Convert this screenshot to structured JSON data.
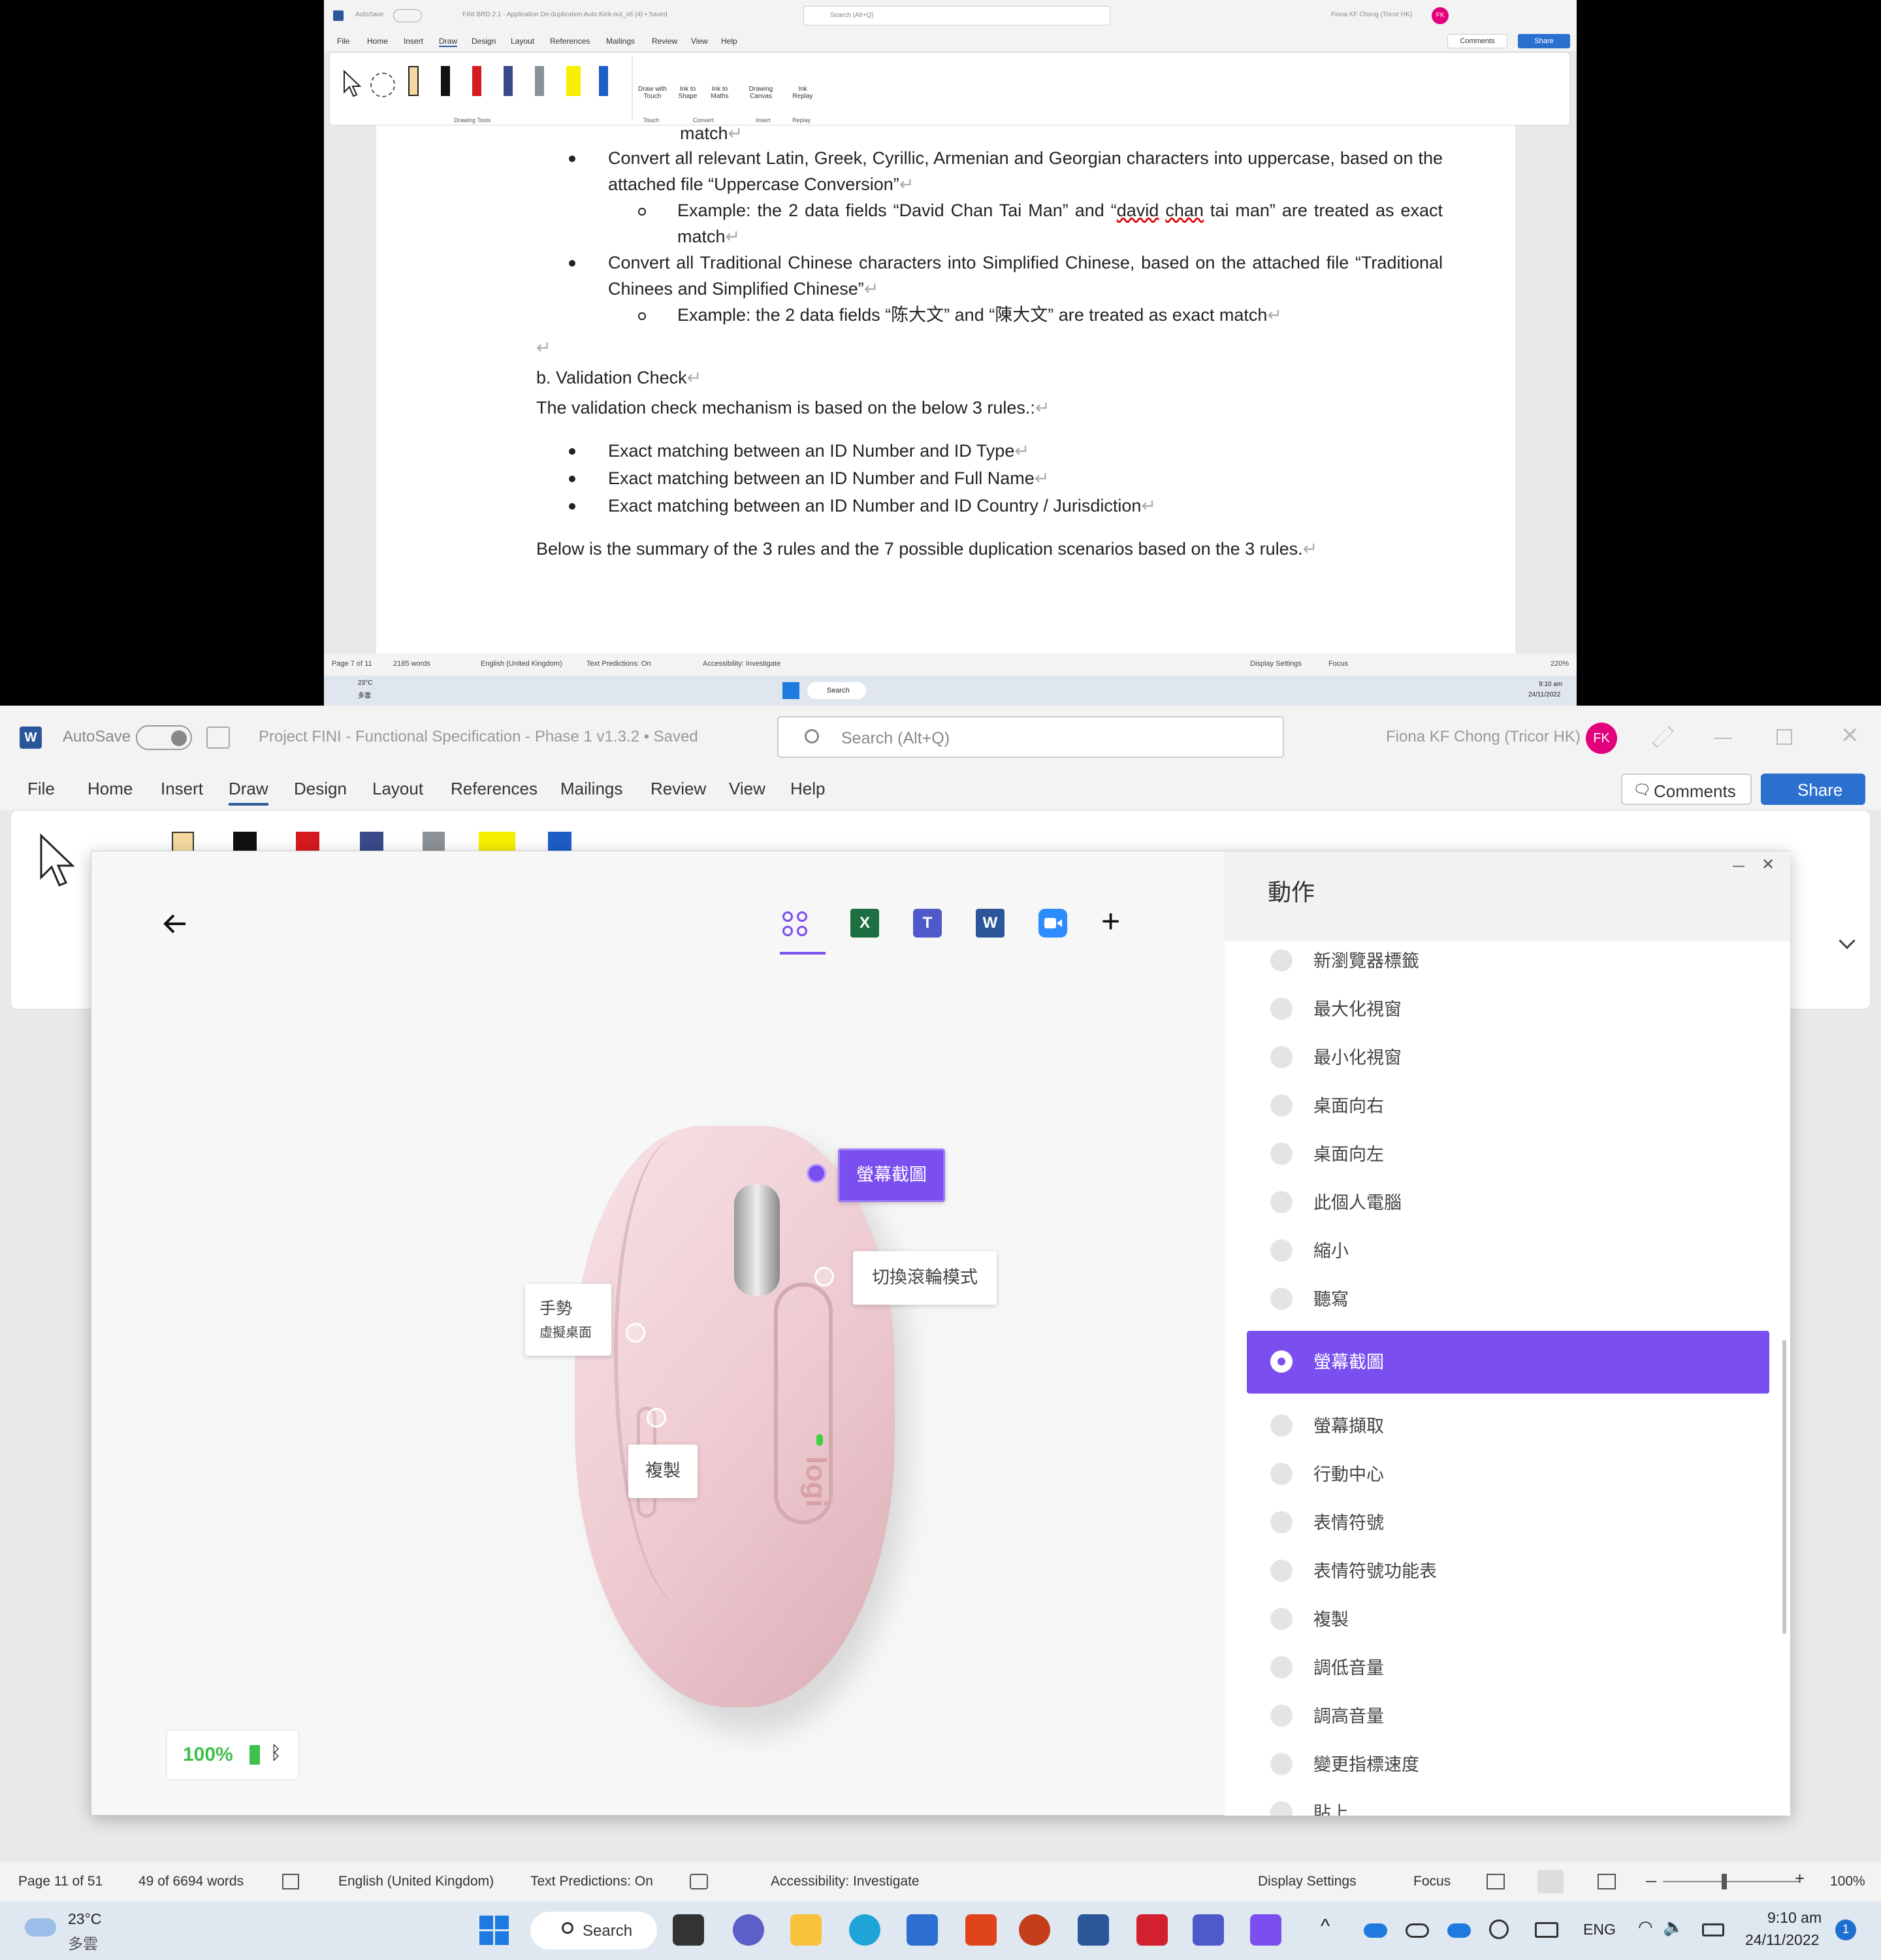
{
  "top_window": {
    "title": {
      "autosave": "AutoSave",
      "doc_title": "FINI BRD 2.1 - Application De-duplication Auto Kick-out_v6 (4) • Saved",
      "search_placeholder": "Search (Alt+Q)",
      "user": "Fiona KF Chong (Tricor HK)",
      "initials": "FK"
    },
    "menu": [
      "File",
      "Home",
      "Insert",
      "Draw",
      "Design",
      "Layout",
      "References",
      "Mailings",
      "Review",
      "View",
      "Help"
    ],
    "comments": "Comments",
    "share": "Share",
    "ribbon": {
      "touch_btn": "Draw with Touch",
      "ink_shape": "Ink to Shape",
      "ink_maths": "Ink to Maths",
      "drawing_canvas": "Drawing Canvas",
      "ink_replay": "Ink Replay",
      "groups": [
        "Drawing Tools",
        "Touch",
        "Convert",
        "Insert",
        "Replay"
      ]
    },
    "doc": {
      "line0": "match",
      "b1": "Convert all relevant Latin, Greek, Cyrillic, Armenian and Georgian characters into uppercase, based on the attached file “Uppercase Conversion”",
      "b1_ex_a": "Example: the 2 data fields “David Chan Tai Man” and “",
      "b1_ex_b1": "david",
      "b1_ex_b2": "chan",
      "b1_ex_c": " tai man” are treated as exact match",
      "b2": "Convert all Traditional Chinese characters into Simplified Chinese, based on the attached file “Traditional Chinees and Simplified Chinese”",
      "b2_ex": "Example: the 2 data fields “陈大文” and “陳大文” are treated as exact match",
      "heading": "b. Validation Check",
      "intro": "The validation check mechanism is based on the below 3 rules.:",
      "rules": [
        "Exact matching between an ID Number and ID Type",
        "Exact matching between an ID Number and Full Name",
        "Exact matching between an ID Number and ID Country / Jurisdiction"
      ],
      "summary": "Below is the summary of the 3 rules and the 7 possible duplication scenarios based on the 3 rules."
    },
    "status": {
      "page": "Page 7 of 11",
      "words": "2185 words",
      "lang": "English (United Kingdom)",
      "pred": "Text Predictions: On",
      "access": "Accessibility: Investigate",
      "display": "Display Settings",
      "focus": "Focus",
      "zoom": "220%"
    },
    "taskbar": {
      "temp": "23°C",
      "weather": "多雲",
      "search": "Search",
      "time": "9:10 am",
      "date": "24/11/2022"
    }
  },
  "word": {
    "autosave": "AutoSave",
    "doc_title": "Project FINI - Functional Specification - Phase 1 v1.3.2 • Saved",
    "search_placeholder": "Search (Alt+Q)",
    "user": "Fiona KF Chong (Tricor HK)",
    "initials": "FK",
    "menu": [
      "File",
      "Home",
      "Insert",
      "Draw",
      "Design",
      "Layout",
      "References",
      "Mailings",
      "Review",
      "View",
      "Help"
    ],
    "comments": "Comments",
    "share": "Share"
  },
  "options": {
    "panel_title": "動作",
    "battery": "100%",
    "callouts": {
      "screenshot": "螢幕截圖",
      "scroll_mode": "切換滾輪模式",
      "gesture": "手勢",
      "gesture_sub": "虛擬桌面",
      "copy": "複製"
    },
    "logo": "logi",
    "actions": [
      {
        "label": "新瀏覽器標籤",
        "selected": false
      },
      {
        "label": "最大化視窗",
        "selected": false
      },
      {
        "label": "最小化視窗",
        "selected": false
      },
      {
        "label": "桌面向右",
        "selected": false
      },
      {
        "label": "桌面向左",
        "selected": false
      },
      {
        "label": "此個人電腦",
        "selected": false
      },
      {
        "label": "縮小",
        "selected": false
      },
      {
        "label": "聽寫",
        "selected": false
      },
      {
        "label": "螢幕截圖",
        "selected": true
      },
      {
        "label": "螢幕擷取",
        "selected": false
      },
      {
        "label": "行動中心",
        "selected": false
      },
      {
        "label": "表情符號",
        "selected": false
      },
      {
        "label": "表情符號功能表",
        "selected": false
      },
      {
        "label": "複製",
        "selected": false
      },
      {
        "label": "調低音量",
        "selected": false
      },
      {
        "label": "調高音量",
        "selected": false
      },
      {
        "label": "變更指標速度",
        "selected": false
      },
      {
        "label": "貼上",
        "selected": false
      }
    ],
    "accent": "#7b4ef0"
  },
  "status": {
    "page": "Page 11 of 51",
    "words": "49 of 6694 words",
    "lang": "English (United Kingdom)",
    "pred": "Text Predictions: On",
    "access": "Accessibility: Investigate",
    "display": "Display Settings",
    "focus": "Focus",
    "zoom": "100%"
  },
  "taskbar": {
    "temp": "23°C",
    "weather": "多雲",
    "search": "Search",
    "lang": "ENG",
    "time": "9:10 am",
    "date": "24/11/2022",
    "badge": "1"
  }
}
